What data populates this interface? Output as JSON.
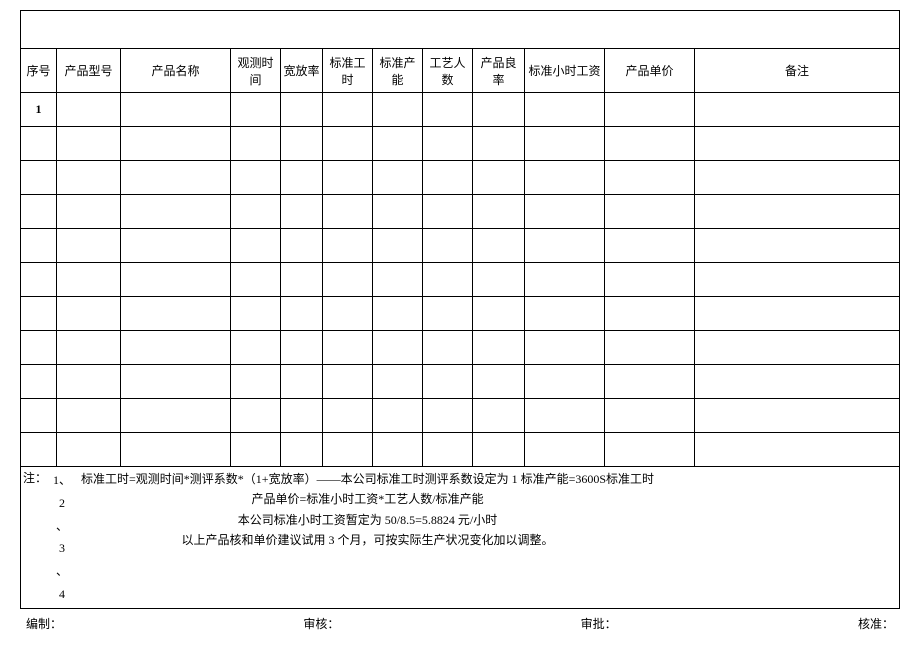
{
  "table": {
    "headers": {
      "seq": "序号",
      "model": "产品型号",
      "name": "产品名称",
      "obs_time": "观测时间",
      "allowance": "宽放率",
      "std_hours": "标准工时",
      "std_capacity": "标准产能",
      "workers": "工艺人数",
      "yield": "产品良率",
      "hourly_wage": "标准小时工资",
      "unit_price": "产品单价",
      "remark": "备注"
    },
    "rows": [
      {
        "seq": "1"
      },
      {
        "seq": ""
      },
      {
        "seq": ""
      },
      {
        "seq": ""
      },
      {
        "seq": ""
      },
      {
        "seq": ""
      },
      {
        "seq": ""
      },
      {
        "seq": ""
      },
      {
        "seq": ""
      },
      {
        "seq": ""
      },
      {
        "seq": ""
      }
    ]
  },
  "notes": {
    "label": "注：",
    "nums": [
      "1、",
      "2",
      "、",
      "3",
      "、",
      "4"
    ],
    "lines": [
      "标准工时=观测时间*测评系数*（1+宽放率）——本公司标准工时测评系数设定为 1 标准产能=3600S标准工时",
      "产品单价=标准小时工资*工艺人数/标准产能",
      "本公司标准小时工资暂定为 50/8.5=5.8824 元/小时",
      "以上产品核和单价建议试用 3 个月，可按实际生产状况变化加以调整。"
    ]
  },
  "footer": {
    "prepared": "编制：",
    "reviewed": "审核：",
    "approved": "审批：",
    "verified": "核准："
  }
}
